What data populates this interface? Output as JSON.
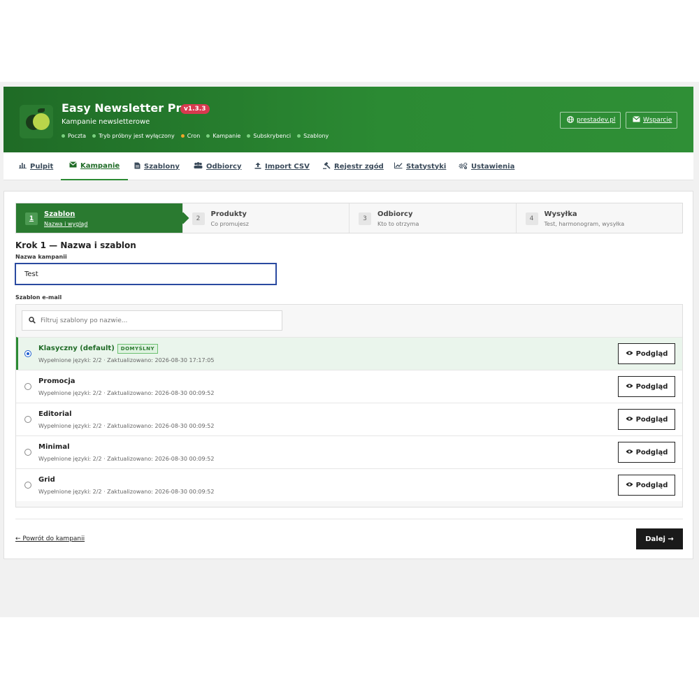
{
  "app": {
    "title": "Easy Newsletter Pro",
    "version": "v1.3.3",
    "subtitle": "Kampanie newsletterowe",
    "statuses": [
      {
        "label": "Poczta",
        "color": "#7ad07f"
      },
      {
        "label": "Tryb próbny jest wyłączony",
        "color": "#7ad07f"
      },
      {
        "label": "Cron",
        "color": "#f0a52a"
      },
      {
        "label": "Kampanie",
        "color": "#7ad07f"
      },
      {
        "label": "Subskrybenci",
        "color": "#7ad07f"
      },
      {
        "label": "Szablony",
        "color": "#7ad07f"
      }
    ],
    "site_link": "prestadev.pl",
    "support_link": "Wsparcie"
  },
  "nav": {
    "items": [
      {
        "label": "Pulpit",
        "icon": "chart-icon"
      },
      {
        "label": "Kampanie",
        "icon": "envelope-icon"
      },
      {
        "label": "Szablony",
        "icon": "file-icon"
      },
      {
        "label": "Odbiorcy",
        "icon": "users-icon"
      },
      {
        "label": "Import CSV",
        "icon": "upload-icon"
      },
      {
        "label": "Rejestr zgód",
        "icon": "gavel-icon"
      },
      {
        "label": "Statystyki",
        "icon": "line-chart-icon"
      },
      {
        "label": "Ustawienia",
        "icon": "cogs-icon"
      }
    ],
    "active": "Kampanie"
  },
  "steps": [
    {
      "num": "1",
      "title": "Szablon",
      "sub": "Nazwa i wygląd"
    },
    {
      "num": "2",
      "title": "Produkty",
      "sub": "Co promujesz"
    },
    {
      "num": "3",
      "title": "Odbiorcy",
      "sub": "Kto to otrzyma"
    },
    {
      "num": "4",
      "title": "Wysyłka",
      "sub": "Test, harmonogram, wysyłka"
    }
  ],
  "form": {
    "heading": "Krok 1 — Nazwa i szablon",
    "name_label": "Nazwa kampanii",
    "name_value": "Test",
    "template_label": "Szablon e-mail",
    "filter_placeholder": "Filtruj szablony po nazwie..."
  },
  "templates": [
    {
      "name": "Klasyczny (default)",
      "badge": "DOMYŚLNY",
      "meta": "Wypełnione języki: 2/2  ·  Zaktualizowano: 2026-08-30 17:17:05",
      "selected": true
    },
    {
      "name": "Promocja",
      "badge": "",
      "meta": "Wypełnione języki: 2/2  ·  Zaktualizowano: 2026-08-30 00:09:52",
      "selected": false
    },
    {
      "name": "Editorial",
      "badge": "",
      "meta": "Wypełnione języki: 2/2  ·  Zaktualizowano: 2026-08-30 00:09:52",
      "selected": false
    },
    {
      "name": "Minimal",
      "badge": "",
      "meta": "Wypełnione języki: 2/2  ·  Zaktualizowano: 2026-08-30 00:09:52",
      "selected": false
    },
    {
      "name": "Grid",
      "badge": "",
      "meta": "Wypełnione języki: 2/2  ·  Zaktualizowano: 2026-08-30 00:09:52",
      "selected": false
    }
  ],
  "preview_label": "Podgląd",
  "footer": {
    "back_label": "← Powrót do kampanii",
    "next_label": "Dalej →"
  }
}
